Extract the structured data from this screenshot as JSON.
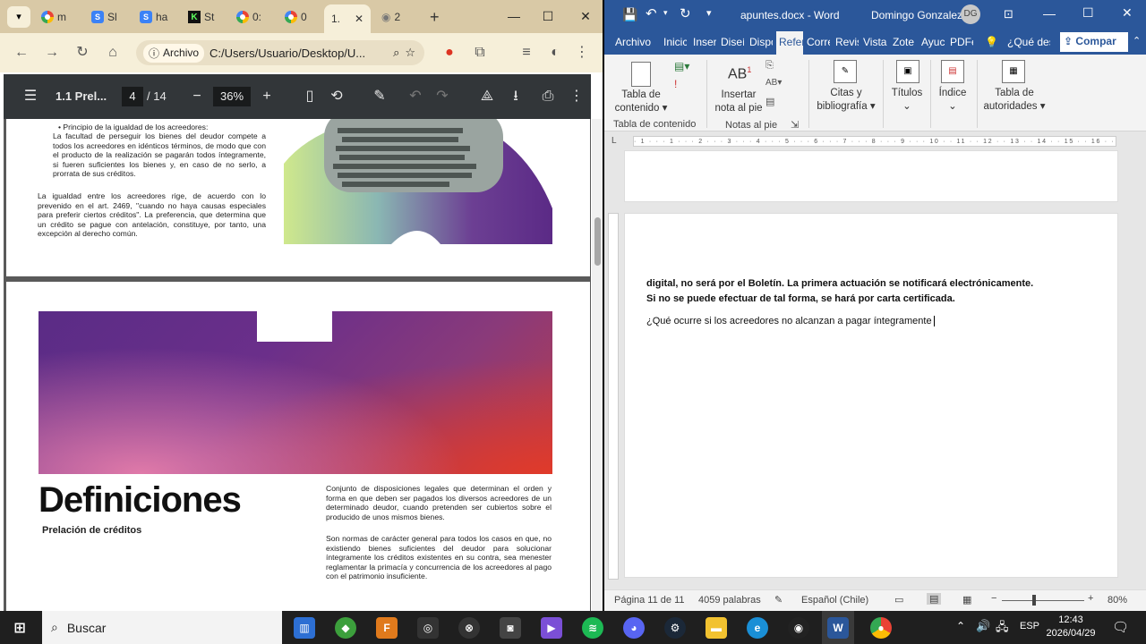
{
  "chrome": {
    "tabs": [
      {
        "label": "m",
        "icon": "google-icon"
      },
      {
        "label": "Sl",
        "icon": "sheets-icon"
      },
      {
        "label": "ha",
        "icon": "sheets-icon"
      },
      {
        "label": "St",
        "icon": "kahoot-icon"
      },
      {
        "label": "0:",
        "icon": "google-icon"
      },
      {
        "label": "0",
        "icon": "google-icon"
      },
      {
        "label": "1.",
        "icon": "pdf-icon"
      },
      {
        "label": "2",
        "icon": "globe-icon"
      }
    ],
    "address_chip": "Archivo",
    "address": "C:/Users/Usuario/Desktop/U...",
    "pdf": {
      "title": "1.1 Prel...",
      "page_current": "4",
      "page_total": "/ 14",
      "zoom": "36%"
    }
  },
  "pdf_content": {
    "bullet_heading": "Principio de la igualdad de los acreedores:",
    "bullet_text": "La facultad de perseguir los bienes del deudor compete a todos los acreedores en idénticos términos, de modo que con el producto de la realización se pagarán todos íntegramente, si fueren suficientes los bienes y, en caso de no serlo, a prorrata de sus créditos.",
    "para": "La igualdad entre los acreedores rige, de acuerdo con lo prevenido en el art. 2469, \"cuando no haya causas especiales para preferir ciertos créditos\". La preferencia, que determina que un crédito se pague con antelación, constituye, por tanto, una excepción al derecho común.",
    "def_title": "Definiciones",
    "def_subtitle": "Prelación de créditos",
    "def_p1": "Conjunto de disposiciones legales que determinan el orden y forma en que deben ser pagados los diversos acreedores de un determinado deudor, cuando pretenden ser cubiertos sobre el producido de unos mismos bienes.",
    "def_p2": "Son normas de carácter general para todos los casos en que, no existiendo bienes suficientes del deudor para solucionar íntegramente los créditos existentes en su contra, sea menester reglamentar la primacía y concurrencia de los acreedores al pago con el patrimonio insuficiente."
  },
  "word": {
    "doc_title": "apuntes.docx - Word",
    "user": "Domingo Gonzalez",
    "user_initials": "DG",
    "tabs": [
      "Archivo",
      "Inicio",
      "Insertar",
      "Diseño",
      "Disposición",
      "Referencias",
      "Correspondencia",
      "Revisar",
      "Vista",
      "Zotero",
      "Ayuda",
      "PDFelement"
    ],
    "tabs_visible": [
      "Archivo",
      "Inicic",
      "Inser",
      "Diseí",
      "Dispo",
      "Refer",
      "Corre",
      "Revis",
      "Vista",
      "Zote",
      "Ayuc",
      "PDFe"
    ],
    "tell_me": "¿Qué des",
    "share": "Compar",
    "ribbon": {
      "toc_label1": "Tabla de",
      "toc_label2": "contenido",
      "toc_group": "Tabla de contenido",
      "footnote_label1": "Insertar",
      "footnote_label2": "nota al pie",
      "footnote_group": "Notas al pie",
      "citations_label1": "Citas y",
      "citations_label2": "bibliografía",
      "captions_label": "Títulos",
      "index_label": "Índice",
      "authorities_label1": "Tabla de",
      "authorities_label2": "autoridades"
    },
    "body": {
      "p1": "digital, no será por el Boletín. La primera actuación se notificará electrónicamente. Si no se puede efectuar de tal forma, se hará por carta certificada.",
      "p2": "¿Qué ocurre si los acreedores no alcanzan a pagar íntegramente"
    },
    "status": {
      "page": "Página 11 de 11",
      "words": "4059 palabras",
      "language": "Español (Chile)",
      "zoom": "80%"
    }
  },
  "taskbar": {
    "search_placeholder": "Buscar",
    "language": "ESP",
    "time": "12:43",
    "date": "2026/04/29"
  },
  "colors": {
    "word_blue": "#2b579a",
    "chrome_tab_bar": "#d9c9a6",
    "pdf_toolbar": "#323639"
  }
}
